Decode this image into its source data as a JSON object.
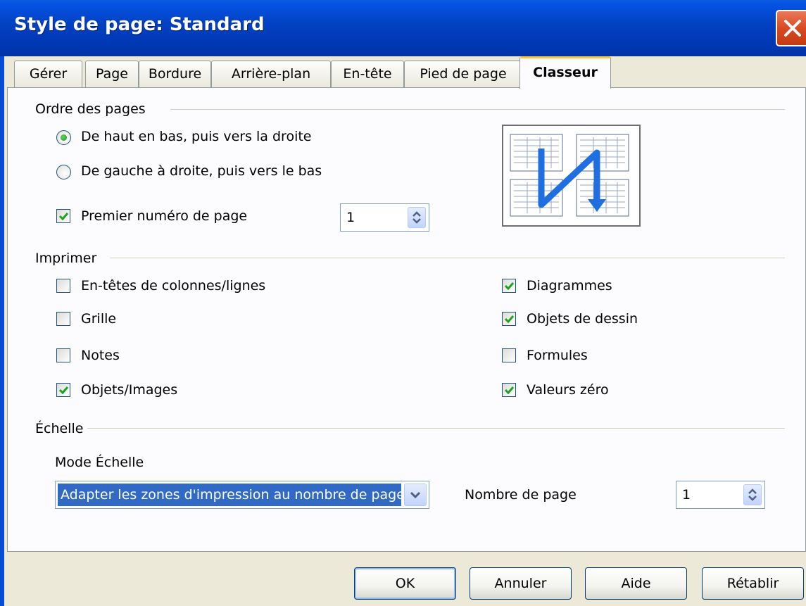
{
  "window": {
    "title": "Style de page: Standard"
  },
  "tabs": [
    "Gérer",
    "Page",
    "Bordure",
    "Arrière-plan",
    "En-tête",
    "Pied de page",
    "Classeur"
  ],
  "active_tab": "Classeur",
  "page_order": {
    "heading": "Ordre des pages",
    "option_top_down": "De haut en bas, puis vers la droite",
    "option_left_right": "De gauche à droite, puis vers le bas",
    "selected": "top_down",
    "first_page_label": "Premier numéro de page",
    "first_page_checked": true,
    "first_page_value": "1"
  },
  "print": {
    "heading": "Imprimer",
    "left": [
      {
        "label": "En-têtes de colonnes/lignes",
        "checked": false
      },
      {
        "label": "Grille",
        "checked": false
      },
      {
        "label": "Notes",
        "checked": false
      },
      {
        "label": "Objets/Images",
        "checked": true
      }
    ],
    "right": [
      {
        "label": "Diagrammes",
        "checked": true
      },
      {
        "label": "Objets de dessin",
        "checked": true
      },
      {
        "label": "Formules",
        "checked": false
      },
      {
        "label": "Valeurs zéro",
        "checked": true
      }
    ]
  },
  "scale": {
    "heading": "Échelle",
    "mode_label": "Mode Échelle",
    "mode_value": "Adapter les zones d'impression au nombre de pages",
    "pages_label": "Nombre de page",
    "pages_value": "1"
  },
  "buttons": {
    "ok": "OK",
    "cancel": "Annuler",
    "help": "Aide",
    "reset": "Rétablir"
  },
  "colors": {
    "titlebar": "#0242c4",
    "dialog_bg": "#ece9d8",
    "panel_bg": "#fcfcfe",
    "check": "#21a121",
    "selection": "#316ac5"
  }
}
